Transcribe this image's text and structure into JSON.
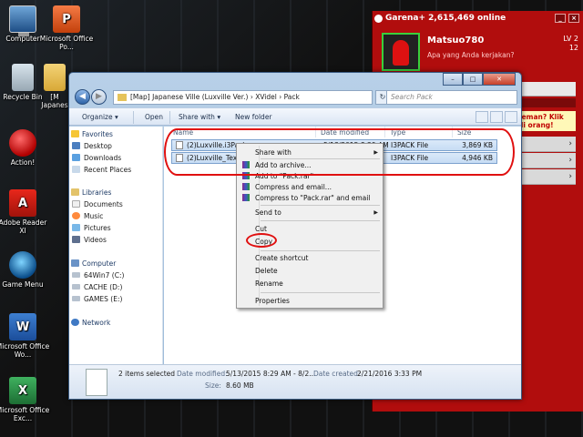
{
  "desktop_icons": [
    {
      "label": "Computer",
      "icon": "computer-icon"
    },
    {
      "label": "Microsoft Office Po...",
      "icon": "powerpoint-icon"
    },
    {
      "label": "Recycle Bin",
      "icon": "recycle-bin-icon"
    },
    {
      "label": "[M Japanes",
      "icon": "folder-icon"
    },
    {
      "label": "Action!",
      "icon": "action-icon"
    },
    {
      "label": "Adobe Reader XI",
      "icon": "pdf-icon"
    },
    {
      "label": "Game Menu",
      "icon": "game-menu-icon"
    },
    {
      "label": "Microsoft Office Wo...",
      "icon": "word-icon"
    },
    {
      "label": "Microsoft Office Exc...",
      "icon": "excel-icon"
    }
  ],
  "garena": {
    "title": "Garena+ 2,615,469 online",
    "username": "Matsuo780",
    "status_prompt": "Apa yang Anda kerjakan?",
    "level": "LV 2",
    "coins": "12",
    "promo": "teman? Klik di orang!"
  },
  "explorer": {
    "address": "[Map] Japanese Ville (Luxville Ver.) › XVidel › Pack",
    "search_placeholder": "Search Pack",
    "toolbar": {
      "organize": "Organize ▾",
      "open": "Open",
      "share": "Share with ▾",
      "new_folder": "New folder"
    },
    "nav": {
      "favorites": "Favorites",
      "desktop": "Desktop",
      "downloads": "Downloads",
      "recent": "Recent Places",
      "libraries": "Libraries",
      "documents": "Documents",
      "music": "Music",
      "pictures": "Pictures",
      "videos": "Videos",
      "computer": "Computer",
      "drive_c": "64Win7  (C:)",
      "drive_d": "CACHE (D:)",
      "drive_e": "GAMES (E:)",
      "network": "Network"
    },
    "columns": {
      "name": "Name",
      "date": "Date modified",
      "type": "Type",
      "size": "Size"
    },
    "files": [
      {
        "name": "(2)Luxville.i3Pack",
        "date": "5/13/2015 8:29 AM",
        "type": "I3PACK File",
        "size": "3,869 KB"
      },
      {
        "name": "(2)Luxville_Textur",
        "date": "",
        "type": "I3PACK File",
        "size": "4,946 KB"
      }
    ],
    "status": {
      "count": "2 items selected",
      "date_mod_label": "Date modified:",
      "date_mod": "5/13/2015 8:29 AM - 8/2...",
      "date_created_label": "Date created:",
      "date_created": "2/21/2016 3:33 PM",
      "size_label": "Size:",
      "size": "8.60 MB"
    }
  },
  "context_menu": {
    "share_with": "Share with",
    "add_archive": "Add to archive...",
    "add_rar": "Add to \"Pack.rar\"",
    "compress_email": "Compress and email...",
    "compress_rar_email": "Compress to \"Pack.rar\" and email",
    "send_to": "Send to",
    "cut": "Cut",
    "copy": "Copy",
    "create_shortcut": "Create shortcut",
    "delete": "Delete",
    "rename": "Rename",
    "properties": "Properties"
  },
  "colors": {
    "annotation": "#e01010",
    "garena_red": "#b10d0d",
    "selection": "#c6dcf4"
  }
}
